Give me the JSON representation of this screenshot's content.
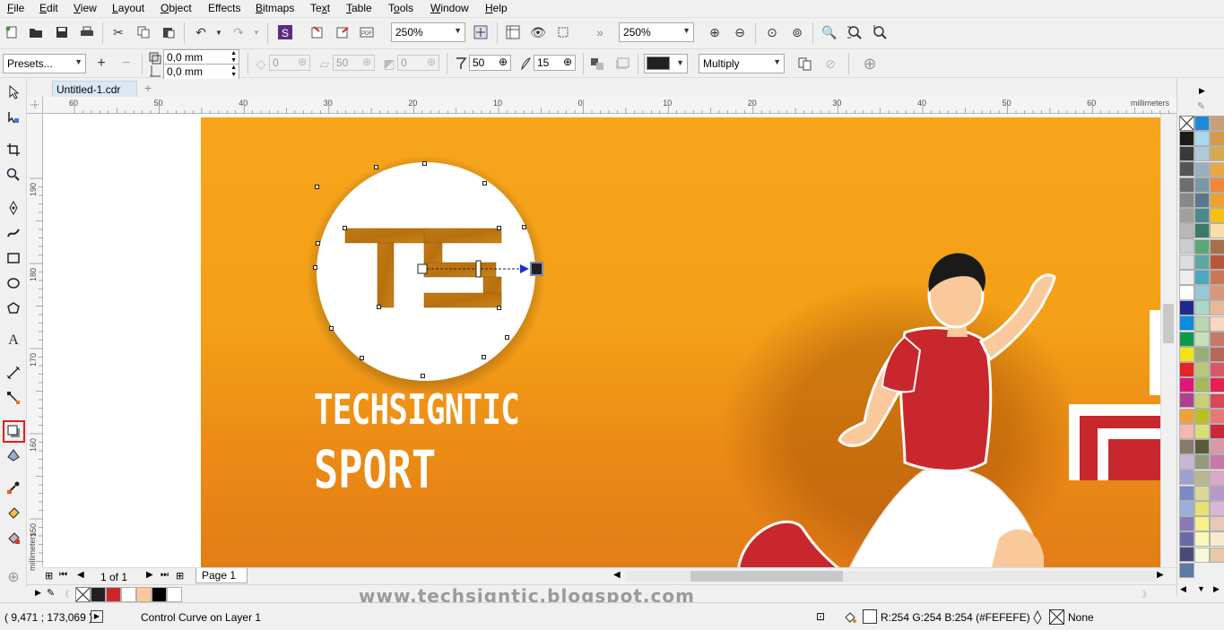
{
  "menu": [
    "File",
    "Edit",
    "View",
    "Layout",
    "Object",
    "Effects",
    "Bitmaps",
    "Text",
    "Table",
    "Tools",
    "Window",
    "Help"
  ],
  "menu_underline": [
    "F",
    "E",
    "V",
    "L",
    "O",
    "C",
    "B",
    "x",
    "T",
    "o",
    "W",
    "H"
  ],
  "toolbar": {
    "zoom_level": "250%",
    "zoom_level_2": "250%"
  },
  "property_bar": {
    "presets": "Presets...",
    "offset_x": "0,0 mm",
    "offset_y": "0,0 mm",
    "angle": "0",
    "stretch": "50",
    "fade": "0",
    "opacity": "50",
    "feathering": "15",
    "blend_mode": "Multiply",
    "shadow_color": "#231f20"
  },
  "document": {
    "tab_title": "Untitled-1.cdr",
    "page_counter": "1 of 1",
    "page_tab": "Page 1"
  },
  "rulers": {
    "units": "millimeters",
    "h_ticks": [
      "60",
      "50",
      "40",
      "30",
      "20",
      "10",
      "0",
      "10",
      "20",
      "30",
      "40",
      "50",
      "60"
    ],
    "v_ticks": [
      "190",
      "180",
      "170",
      "160",
      "150"
    ]
  },
  "artwork": {
    "logo_letters": "TS",
    "line1": "TECHSIGNTIC",
    "line2": "SPORT",
    "watermark": "www.techsigntic.blogspot.com"
  },
  "status": {
    "coordinates": "( 9,471 ; 173,069 )",
    "message": "Control Curve on Layer 1",
    "fill_color_info": "R:254 G:254 B:254 (#FEFEFE)",
    "outline": "None"
  },
  "colors": {
    "accent_orange": "#f4a018",
    "shirt_red": "#c8282d",
    "skin": "#f9c99b"
  },
  "palette_left": [
    "#1a1a1a",
    "#3a3a3a",
    "#555555",
    "#6e6e6e",
    "#888888",
    "#a0a0a0",
    "#b8b8b8",
    "#cccccc",
    "#dddddd",
    "#eeeeee",
    "#ffffff",
    "#1d2b8f",
    "#0a8be0",
    "#0b9a4a",
    "#f5e31a",
    "#e6232a",
    "#e0177a",
    "#b13f8f",
    "#f0a03a",
    "#f4b8b0",
    "#8a7a6a",
    "#c8b6d8",
    "#a0a0d0",
    "#7a8ac8",
    "#9ab0d8",
    "#8a7ab8",
    "#6a6aa8",
    "#4a4a7a",
    "#5a7aa8"
  ],
  "palette_mid": [
    "#1a8bd8",
    "#a8d8f0",
    "#b0c8d8",
    "#98b0c0",
    "#7a98a8",
    "#5a7888",
    "#4a8a8a",
    "#3a7a6a",
    "#5aa878",
    "#5aa8a0",
    "#4aa8c0",
    "#98c8d8",
    "#a8d8c8",
    "#b8d8b0",
    "#c8e0b8",
    "#98b078",
    "#b8c878",
    "#a8b858",
    "#c8d070",
    "#b8c020",
    "#d8e070",
    "#5a5a38",
    "#98987a",
    "#b8b890",
    "#d8d898",
    "#e8e070",
    "#f8f088",
    "#f8f8b8",
    "#f8f8d8"
  ],
  "palette_right": [
    "#c8a078",
    "#d89a48",
    "#d8a850",
    "#e8a848",
    "#f08838",
    "#f0a030",
    "#f8c010",
    "#f8e0a8",
    "#a87048",
    "#b85838",
    "#c87858",
    "#d89878",
    "#e8b898",
    "#f8d8c0",
    "#c87868",
    "#b86858",
    "#d85868",
    "#e82050",
    "#d84858",
    "#e87878",
    "#c82838",
    "#d898a8",
    "#c878a8",
    "#d8a8c8",
    "#b898c8",
    "#d8b8d8",
    "#e8c8b8",
    "#f8e8d0",
    "#e8c8a8"
  ],
  "doc_palette": [
    "#231f20",
    "#c8282d",
    "#ffffff",
    "#f9c99b",
    "#000000",
    "#ffffff"
  ]
}
